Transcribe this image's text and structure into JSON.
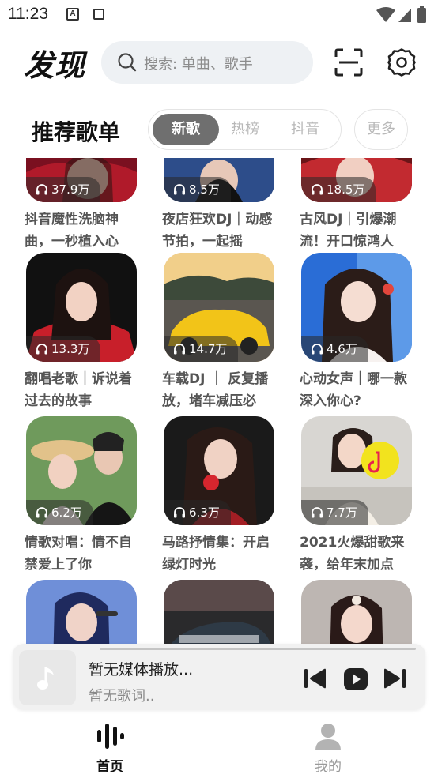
{
  "status_bar": {
    "time": "11:23",
    "notification_badge": "A"
  },
  "header": {
    "title": "发现",
    "search_placeholder": "搜索: 单曲、歌手"
  },
  "section": {
    "title": "推荐歌单",
    "tabs": [
      {
        "label": "新歌",
        "active": true
      },
      {
        "label": "热榜",
        "active": false
      },
      {
        "label": "抖音",
        "active": false
      }
    ],
    "more_label": "更多"
  },
  "playlists": [
    {
      "plays": "37.9万",
      "title": "抖音魔性洗脑神曲，一秒植入心"
    },
    {
      "plays": "8.5万",
      "title": "夜店狂欢DJ｜动感节拍，一起摇"
    },
    {
      "plays": "18.5万",
      "title": "古风DJ｜引爆潮流！开口惊鸿人"
    },
    {
      "plays": "13.3万",
      "title": "翻唱老歌｜诉说着过去的故事"
    },
    {
      "plays": "14.7万",
      "title": "车载DJ ｜ 反复播放，堵车减压必"
    },
    {
      "plays": "4.6万",
      "title": "心动女声｜哪一款深入你心?"
    },
    {
      "plays": "6.2万",
      "title": "情歌对唱：情不自禁爱上了你"
    },
    {
      "plays": "6.3万",
      "title": "马路抒情集：开启绿灯时光"
    },
    {
      "plays": "7.7万",
      "title": "2021火爆甜歌来袭，给年末加点"
    }
  ],
  "player": {
    "title": "暂无媒体播放...",
    "lyric": "暂无歌词.."
  },
  "bottom_nav": [
    {
      "label": "首页",
      "active": true
    },
    {
      "label": "我的",
      "active": false
    }
  ],
  "colors": {
    "accent": "#6f6f6f",
    "search_bg": "#eef1f4",
    "player_bg": "#f1f1f1"
  }
}
